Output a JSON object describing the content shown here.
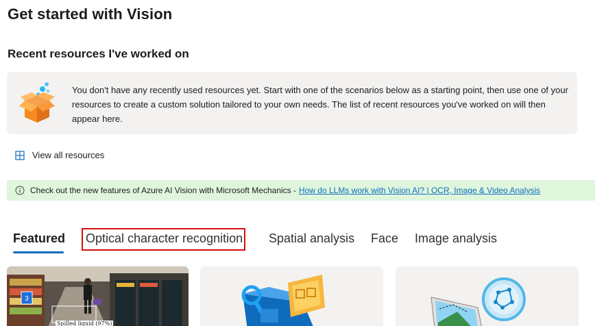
{
  "page": {
    "title": "Get started with Vision"
  },
  "recent": {
    "heading": "Recent resources I've worked on",
    "empty_message": "You don't have any recently used resources yet. Start with one of the scenarios below as a starting point, then use one of your resources to create a custom solution tailored to your own needs. The list of recent resources you've worked on will then appear here.",
    "illustration_icon": "open-box-icon",
    "view_all_label": "View all resources",
    "view_all_icon": "grid-icon"
  },
  "banner": {
    "text": "Check out the new features of Azure AI Vision with Microsoft Mechanics -",
    "link_text": "How do LLMs work with Vision AI? | OCR, Image & Video Analysis",
    "icon": "info-icon",
    "background": "#dff6dd"
  },
  "tabs": [
    {
      "label": "Featured",
      "active": true
    },
    {
      "label": "Optical character recognition",
      "active": false,
      "highlighted": true
    },
    {
      "label": "Spatial analysis",
      "active": false
    },
    {
      "label": "Face",
      "active": false
    },
    {
      "label": "Image analysis",
      "active": false
    }
  ],
  "cards": [
    {
      "image": "store-aisle-photo",
      "caption": "Spilled liquid (97%)",
      "marker": "3"
    },
    {
      "image": "ocr-illustration",
      "caption": ""
    },
    {
      "image": "image-analysis-illustration",
      "caption": ""
    }
  ],
  "colors": {
    "accent": "#0f6cbd",
    "highlight_border": "#d40c0c",
    "panel": "#f3f2f1",
    "banner": "#dff6dd"
  }
}
